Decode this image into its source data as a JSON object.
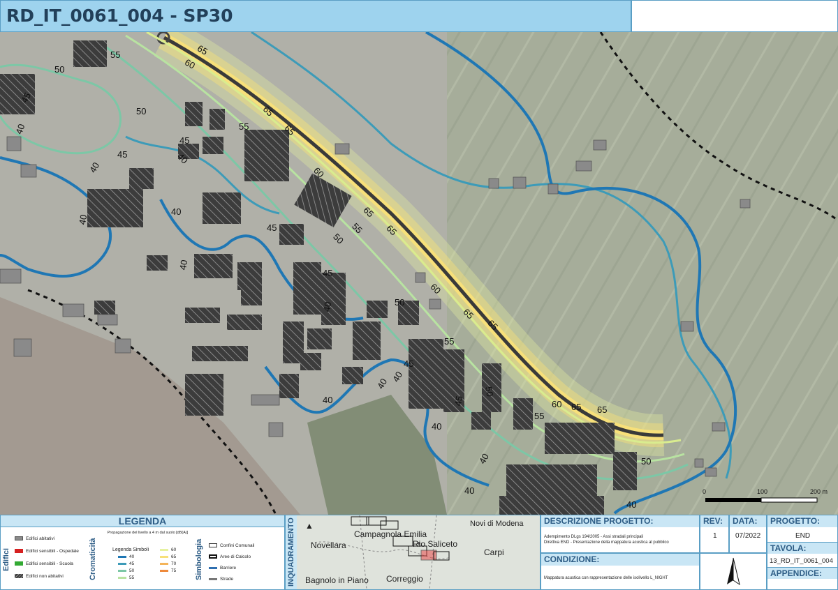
{
  "title": "RD_IT_0061_004 - SP30",
  "map": {
    "contour_labels": [
      "65",
      "60",
      "55",
      "50",
      "45",
      "40"
    ],
    "scale_bar": {
      "labels": [
        "0",
        "100",
        "200 m"
      ]
    }
  },
  "legend": {
    "header": "LEGENDA",
    "edifici_label": "Edifici",
    "edifici_items": [
      "Edifici abitativi",
      "Edifici sensibili - Ospedale",
      "Edifici sensibili - Scuola",
      "Edifici non abitativi"
    ],
    "cromaticita_label": "Cromaticità",
    "prop_note": "Propagazione del livello a 4 m dal suolo [dB(A)]",
    "simboli_title": "Legenda Simboli",
    "levels_left": [
      "40",
      "45",
      "50",
      "55"
    ],
    "levels_right": [
      "60",
      "65",
      "70",
      "75"
    ],
    "level_colors": {
      "40": "#1f77b4",
      "45": "#3d9bb8",
      "50": "#7cc7a6",
      "55": "#b8e3a1",
      "60": "#e6f2a0",
      "65": "#f7e07a",
      "70": "#f4b45a",
      "75": "#ee8a3c"
    },
    "simbologia_label": "Simbologia",
    "simb_items": [
      "Confini Comunali",
      "Aree di Calcolo",
      "Barriere",
      "Strade"
    ]
  },
  "inquadramento": {
    "label": "INQUADRAMENTO",
    "places": [
      "Novi di Modena",
      "Campagnola Emilia",
      "Novellara",
      "Rio Saliceto",
      "Carpi",
      "Bagnolo in Piano",
      "Correggio"
    ]
  },
  "descrizione": {
    "header": "DESCRIZIONE PROGETTO:",
    "line1": "Adempimento DLgs 194/2005 - Assi stradali principali",
    "line2": "Direttiva END - Presentazione della mappatura acustica al pubblico"
  },
  "rev": {
    "header": "REV:",
    "value": "1"
  },
  "data": {
    "header": "DATA:",
    "value": "07/2022"
  },
  "progetto": {
    "header": "PROGETTO:",
    "value": "END"
  },
  "tavola": {
    "header": "TAVOLA:",
    "value": "13_RD_IT_0061_004"
  },
  "appendice": {
    "header": "APPENDICE:"
  },
  "condizione": {
    "header": "CONDIZIONE:",
    "text": "Mappatura acustica con rappresentazione delle isolivello L_NIGHT"
  }
}
